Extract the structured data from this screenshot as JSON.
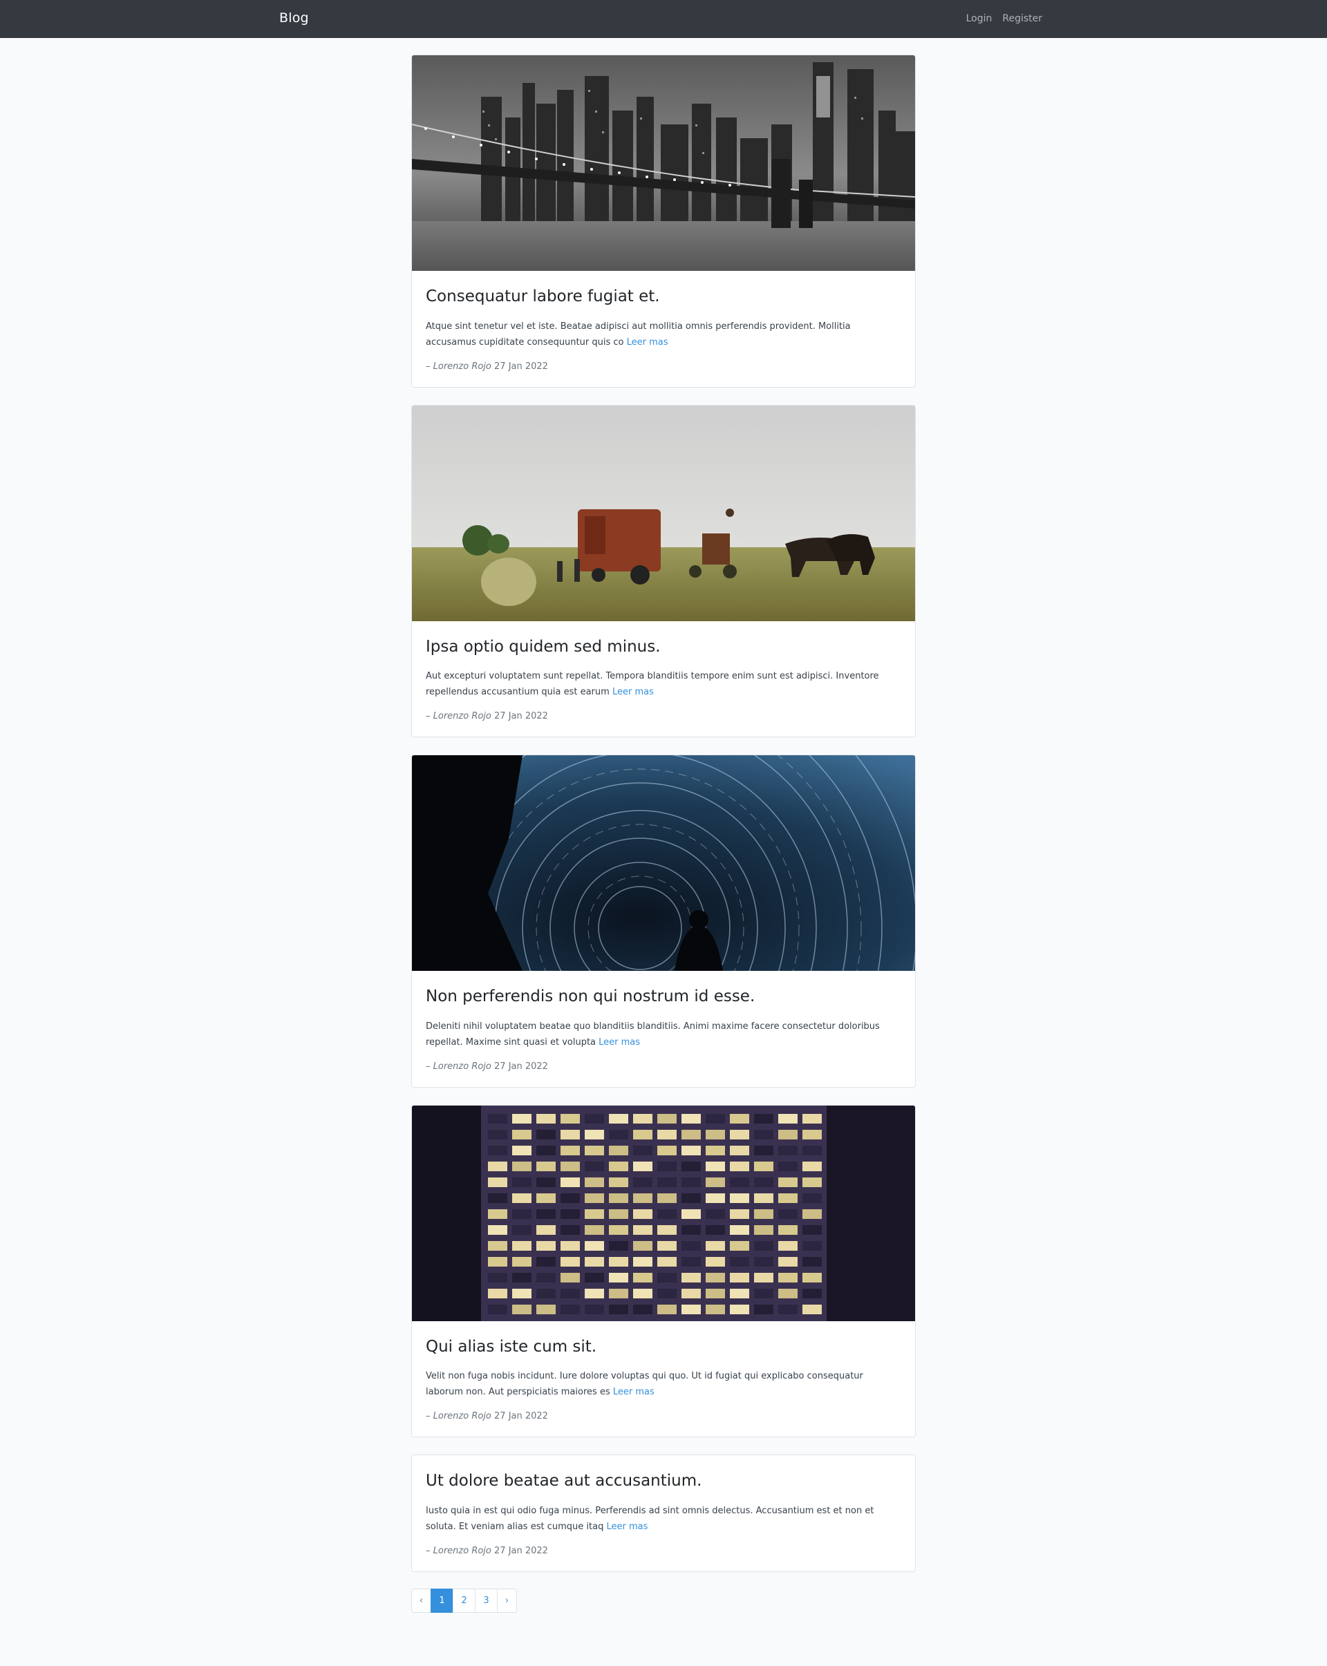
{
  "navbar": {
    "brand": "Blog",
    "links": [
      "Login",
      "Register"
    ]
  },
  "posts": [
    {
      "title": "Consequatur labore fugiat et.",
      "excerpt": "Atque sint tenetur vel et iste. Beatae adipisci aut mollitia omnis perferendis provident. Mollitia accusamus cupiditate consequuntur quis co",
      "read_more": "Leer mas",
      "author": "– Lorenzo Rojo",
      "date": "27 Jan 2022",
      "image": "black-and-white-city-bridge-night"
    },
    {
      "title": "Ipsa optio quidem sed minus.",
      "excerpt": "Aut excepturi voluptatem sunt repellat. Tempora blanditiis tempore enim sunt est adipisci. Inventore repellendus accusantium quia est earum",
      "read_more": "Leer mas",
      "author": "– Lorenzo Rojo",
      "date": "27 Jan 2022",
      "image": "farm-horses-hay-baler-field"
    },
    {
      "title": "Non perferendis non qui nostrum id esse.",
      "excerpt": "Deleniti nihil voluptatem beatae quo blanditiis blanditiis. Animi maxime facere consectetur doloribus repellat. Maxime sint quasi et volupta",
      "read_more": "Leer mas",
      "author": "– Lorenzo Rojo",
      "date": "27 Jan 2022",
      "image": "star-trails-night-sky-silhouette"
    },
    {
      "title": "Qui alias iste cum sit.",
      "excerpt": "Velit non fuga nobis incidunt. Iure dolore voluptas qui quo. Ut id fugiat qui explicabo consequatur laborum non. Aut perspiciatis maiores es",
      "read_more": "Leer mas",
      "author": "– Lorenzo Rojo",
      "date": "27 Jan 2022",
      "image": "office-building-lit-windows-night"
    },
    {
      "title": "Ut dolore beatae aut accusantium.",
      "excerpt": "Iusto quia in est qui odio fuga minus. Perferendis ad sint omnis delectus. Accusantium est et non et soluta. Et veniam alias est cumque itaq",
      "read_more": "Leer mas",
      "author": "– Lorenzo Rojo",
      "date": "27 Jan 2022",
      "image": ""
    }
  ],
  "pagination": {
    "prev": "‹",
    "pages": [
      "1",
      "2",
      "3"
    ],
    "next": "›",
    "active": "1"
  },
  "colors": {
    "navbar": "#343a40",
    "link": "#3490dc",
    "background": "#f8fafc"
  }
}
